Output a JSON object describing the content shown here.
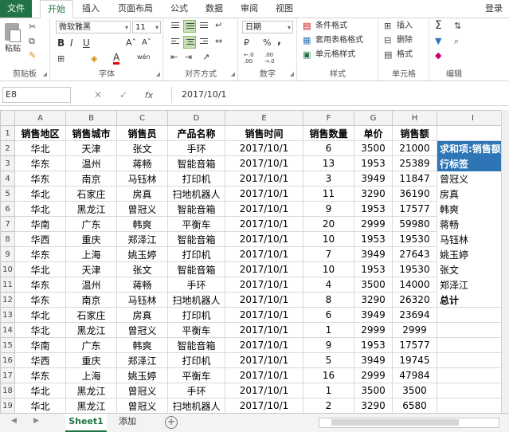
{
  "tabs": {
    "file": "文件",
    "home": "开始",
    "insert": "插入",
    "layout": "页面布局",
    "formulas": "公式",
    "data": "数据",
    "review": "审阅",
    "view": "视图",
    "login": "登录"
  },
  "ribbon": {
    "clipboard": {
      "paste": "粘贴",
      "label": "剪贴板"
    },
    "font": {
      "name": "微软雅黑",
      "size": "11",
      "bold": "B",
      "italic": "I",
      "underline": "U",
      "grow": "Aˆ",
      "shrink": "Aˇ",
      "color_letter": "A",
      "wen": "wén",
      "label": "字体"
    },
    "alignment": {
      "label": "对齐方式"
    },
    "number": {
      "format": "日期",
      "percent": "%",
      "comma": ",",
      "label": "数字",
      "inc": "←.0\n.00",
      "dec": ".00\n→.0"
    },
    "styles": {
      "conditional": "条件格式",
      "table": "套用表格格式",
      "cell": "单元格样式",
      "label": "样式"
    },
    "cells": {
      "insert": "插入",
      "delete": "删除",
      "format": "格式",
      "label": "单元格"
    },
    "editing": {
      "sigma": "Σ",
      "label": "编辑"
    }
  },
  "formula_bar": {
    "name_box": "E8",
    "fx": "fx",
    "value": "2017/10/1"
  },
  "columns": [
    "A",
    "B",
    "C",
    "D",
    "E",
    "F",
    "G",
    "H",
    "I"
  ],
  "headers": [
    "销售地区",
    "销售城市",
    "销售员",
    "产品名称",
    "销售时间",
    "销售数量",
    "单价",
    "销售额"
  ],
  "rows": [
    [
      "华北",
      "天津",
      "张文",
      "手环",
      "2017/10/1",
      "6",
      "3500",
      "21000"
    ],
    [
      "华东",
      "温州",
      "蒋畅",
      "智能音箱",
      "2017/10/1",
      "13",
      "1953",
      "25389"
    ],
    [
      "华东",
      "南京",
      "马钰林",
      "打印机",
      "2017/10/1",
      "3",
      "3949",
      "11847"
    ],
    [
      "华北",
      "石家庄",
      "房真",
      "扫地机器人",
      "2017/10/1",
      "11",
      "3290",
      "36190"
    ],
    [
      "华北",
      "黑龙江",
      "曾冠义",
      "智能音箱",
      "2017/10/1",
      "9",
      "1953",
      "17577"
    ],
    [
      "华南",
      "广东",
      "韩爽",
      "平衡车",
      "2017/10/1",
      "20",
      "2999",
      "59980"
    ],
    [
      "华西",
      "重庆",
      "郑泽江",
      "智能音箱",
      "2017/10/1",
      "10",
      "1953",
      "19530"
    ],
    [
      "华东",
      "上海",
      "姚玉婷",
      "打印机",
      "2017/10/1",
      "7",
      "3949",
      "27643"
    ],
    [
      "华北",
      "天津",
      "张文",
      "智能音箱",
      "2017/10/1",
      "10",
      "1953",
      "19530"
    ],
    [
      "华东",
      "温州",
      "蒋畅",
      "手环",
      "2017/10/1",
      "4",
      "3500",
      "14000"
    ],
    [
      "华东",
      "南京",
      "马钰林",
      "扫地机器人",
      "2017/10/1",
      "8",
      "3290",
      "26320"
    ],
    [
      "华北",
      "石家庄",
      "房真",
      "打印机",
      "2017/10/1",
      "6",
      "3949",
      "23694"
    ],
    [
      "华北",
      "黑龙江",
      "曾冠义",
      "平衡车",
      "2017/10/1",
      "1",
      "2999",
      "2999"
    ],
    [
      "华南",
      "广东",
      "韩爽",
      "智能音箱",
      "2017/10/1",
      "9",
      "1953",
      "17577"
    ],
    [
      "华西",
      "重庆",
      "郑泽江",
      "打印机",
      "2017/10/1",
      "5",
      "3949",
      "19745"
    ],
    [
      "华东",
      "上海",
      "姚玉婷",
      "平衡车",
      "2017/10/1",
      "16",
      "2999",
      "47984"
    ],
    [
      "华北",
      "黑龙江",
      "曾冠义",
      "手环",
      "2017/10/1",
      "1",
      "3500",
      "3500"
    ],
    [
      "华北",
      "黑龙江",
      "曾冠义",
      "扫地机器人",
      "2017/10/1",
      "2",
      "3290",
      "6580"
    ]
  ],
  "pivot": {
    "header1": "求和项:销售额",
    "header2": "行标签",
    "items": [
      "曾冠义",
      "房真",
      "韩爽",
      "蒋畅",
      "马钰林",
      "姚玉婷",
      "张文",
      "郑泽江"
    ],
    "total": "总计"
  },
  "sheets": {
    "active": "Sheet1",
    "other": "添加",
    "add": "+"
  }
}
